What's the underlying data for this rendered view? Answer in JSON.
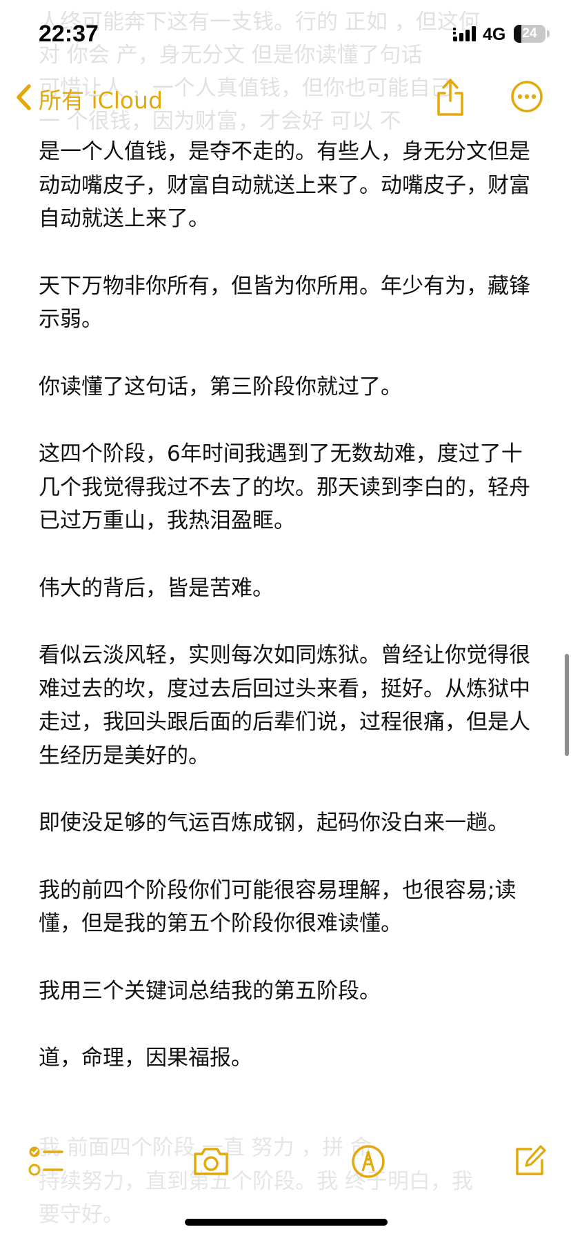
{
  "status_bar": {
    "time": "22:37",
    "network": "4G",
    "battery_level": 24,
    "battery_text": "24"
  },
  "nav": {
    "back_label": "所有 iCloud",
    "back_icon": "chevron-left-icon",
    "share_icon": "share-icon",
    "more_icon": "more-ellipsis-icon",
    "accent_color": "#e3a90a"
  },
  "note": {
    "faded_top_text": "人终可能奔下这有一支钱。行的 正如 ，但这何\n对 你会 产，身无分文 但是你读懂了句话\n可惜让人 ，一个人真值钱，但你也可能自己\n一 个很钱，因为财富，才会好 可以 不",
    "paragraphs": [
      "是一个人值钱，是夺不走的。有些人，身无分文但是动动嘴皮子，财富自动就送上来了。动嘴皮子，财富自动就送上来了。",
      "天下万物非你所有，但皆为你所用。年少有为，藏锋示弱。",
      "你读懂了这句话，第三阶段你就过了。",
      "这四个阶段，6年时间我遇到了无数劫难，度过了十几个我觉得我过不去了的坎。那天读到李白的，轻舟已过万重山，我热泪盈眶。",
      "伟大的背后，皆是苦难。",
      "看似云淡风轻，实则每次如同炼狱。曾经让你觉得很难过去的坎，度过去后回过头来看，挺好。从炼狱中走过，我回头跟后面的后辈们说，过程很痛，但是人生经历是美好的。",
      "即使没足够的气运百炼成钢，起码你没白来一趟。",
      "我的前四个阶段你们可能很容易理解，也很容易;读懂，但是我的第五个阶段你很难读懂。",
      "我用三个关键词总结我的第五阶段。",
      "道，命理，因果福报。"
    ],
    "faded_bottom_text": "我 前面四个阶段 一直 努力 ，拼 命\n持续努力，直到第五个阶段。我 终于明白，我\n要守好。"
  },
  "toolbar": {
    "checklist_icon": "checklist-icon",
    "camera_icon": "camera-icon",
    "markup_icon": "markup-pen-icon",
    "compose_icon": "compose-icon"
  }
}
